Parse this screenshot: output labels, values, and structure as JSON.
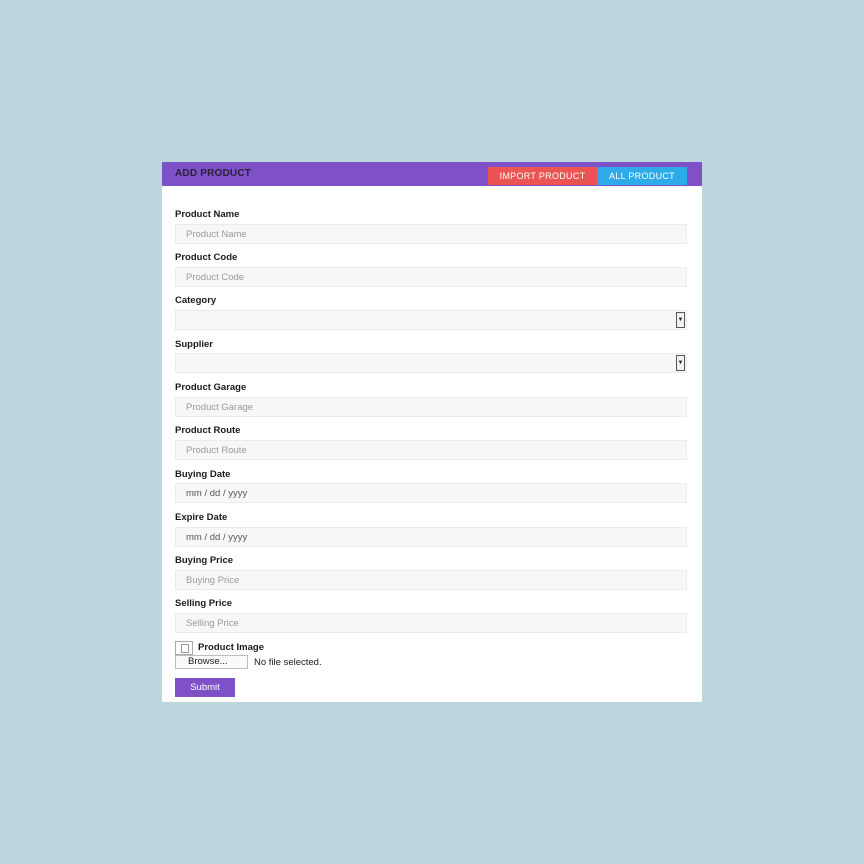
{
  "header": {
    "title": "ADD PRODUCT",
    "import_label": "IMPORT PRODUCT",
    "all_label": "ALL PRODUCT"
  },
  "fields": {
    "product_name": {
      "label": "Product Name",
      "placeholder": "Product Name"
    },
    "product_code": {
      "label": "Product Code",
      "placeholder": "Product Code"
    },
    "category": {
      "label": "Category",
      "value": ""
    },
    "supplier": {
      "label": "Supplier",
      "value": ""
    },
    "product_garage": {
      "label": "Product Garage",
      "placeholder": "Product Garage"
    },
    "product_route": {
      "label": "Product Route",
      "placeholder": "Product Route"
    },
    "buying_date": {
      "label": "Buying Date",
      "value": "mm / dd / yyyy"
    },
    "expire_date": {
      "label": "Expire Date",
      "value": "mm / dd / yyyy"
    },
    "buying_price": {
      "label": "Buying Price",
      "placeholder": "Buying Price"
    },
    "selling_price": {
      "label": "Selling Price",
      "placeholder": "Selling Price"
    }
  },
  "image": {
    "label": "Product Image",
    "browse_label": "Browse...",
    "status": "No file selected."
  },
  "submit_label": "Submit",
  "colors": {
    "accent": "#7e52c6",
    "import": "#ec5353",
    "all": "#2eaae8",
    "background": "#bdd5dc"
  }
}
